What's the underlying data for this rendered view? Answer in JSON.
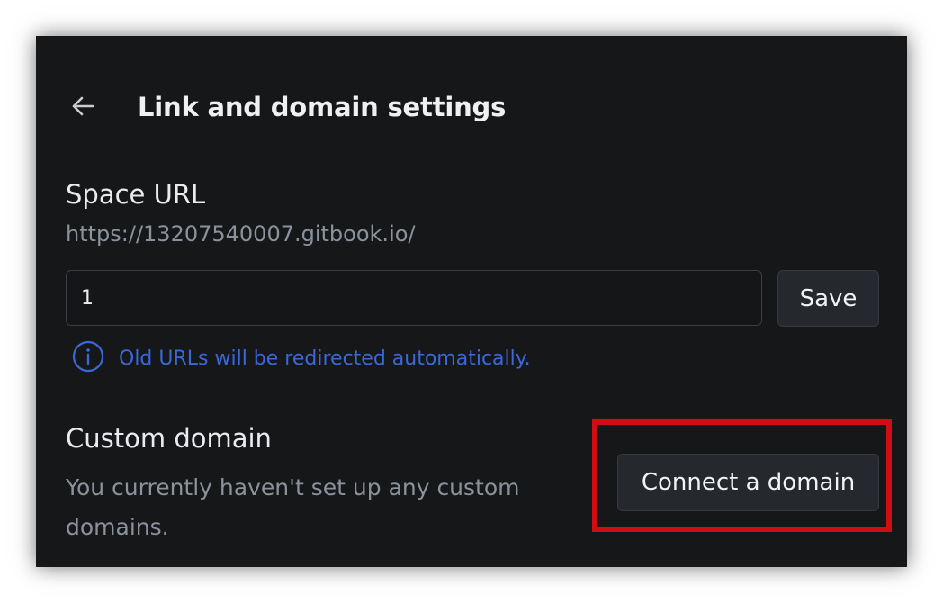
{
  "header": {
    "back_icon": "arrow-left-icon",
    "title": "Link and domain settings"
  },
  "space_url": {
    "heading": "Space URL",
    "prefix": "https://13207540007.gitbook.io/",
    "slug_value": "1",
    "save_label": "Save",
    "hint_icon": "info-icon",
    "hint_text": "Old URLs will be redirected automatically."
  },
  "custom_domain": {
    "heading": "Custom domain",
    "description": "You currently haven't set up any custom domains.",
    "connect_label": "Connect a domain"
  },
  "colors": {
    "panel_background": "#151719",
    "hint_blue": "#3b67d9",
    "highlight_red": "#d10d14"
  }
}
